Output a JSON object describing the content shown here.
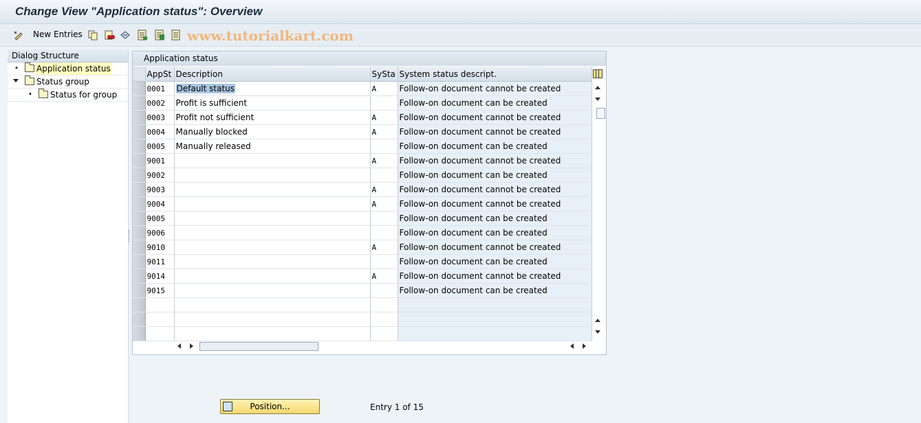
{
  "window": {
    "title": "Change View \"Application status\": Overview"
  },
  "toolbar": {
    "new_entries_label": "New Entries",
    "icons": [
      "edit-pencil-icon",
      "copy-icon",
      "delete-icon",
      "undo-icon",
      "select-all-icon",
      "select-block-icon",
      "deselect-all-icon"
    ],
    "watermark": "www.tutorialkart.com"
  },
  "dialog_structure": {
    "header": "Dialog Structure",
    "items": [
      {
        "label": "Application status",
        "selected": true,
        "level": 0
      },
      {
        "label": "Status group",
        "selected": false,
        "level": 0,
        "expanded": true
      },
      {
        "label": "Status for group",
        "selected": false,
        "level": 1
      }
    ]
  },
  "table": {
    "title": "Application status",
    "columns": [
      "AppSt",
      "Description",
      "SySta",
      "System status descript."
    ],
    "rows": [
      {
        "appst": "0001",
        "desc": "Default status",
        "systa": "A",
        "sysdesc": "Follow-on document cannot be created"
      },
      {
        "appst": "0002",
        "desc": "Profit is sufficient",
        "systa": "",
        "sysdesc": "Follow-on document can be created"
      },
      {
        "appst": "0003",
        "desc": "Profit not sufficient",
        "systa": "A",
        "sysdesc": "Follow-on document cannot be created"
      },
      {
        "appst": "0004",
        "desc": "Manually blocked",
        "systa": "A",
        "sysdesc": "Follow-on document cannot be created"
      },
      {
        "appst": "0005",
        "desc": "Manually released",
        "systa": "",
        "sysdesc": "Follow-on document can be created"
      },
      {
        "appst": "9001",
        "desc": "",
        "systa": "A",
        "sysdesc": "Follow-on document cannot be created"
      },
      {
        "appst": "9002",
        "desc": "",
        "systa": "",
        "sysdesc": "Follow-on document can be created"
      },
      {
        "appst": "9003",
        "desc": "",
        "systa": "A",
        "sysdesc": "Follow-on document cannot be created"
      },
      {
        "appst": "9004",
        "desc": "",
        "systa": "A",
        "sysdesc": "Follow-on document cannot be created"
      },
      {
        "appst": "9005",
        "desc": "",
        "systa": "",
        "sysdesc": "Follow-on document can be created"
      },
      {
        "appst": "9006",
        "desc": "",
        "systa": "",
        "sysdesc": "Follow-on document can be created"
      },
      {
        "appst": "9010",
        "desc": "",
        "systa": "A",
        "sysdesc": "Follow-on document cannot be created"
      },
      {
        "appst": "9011",
        "desc": "",
        "systa": "",
        "sysdesc": "Follow-on document can be created"
      },
      {
        "appst": "9014",
        "desc": "",
        "systa": "A",
        "sysdesc": "Follow-on document cannot be created"
      },
      {
        "appst": "9015",
        "desc": "",
        "systa": "",
        "sysdesc": "Follow-on document can be created"
      }
    ],
    "empty_rows": 3
  },
  "footer": {
    "position_button": "Position...",
    "entry_text": "Entry 1 of 15"
  }
}
